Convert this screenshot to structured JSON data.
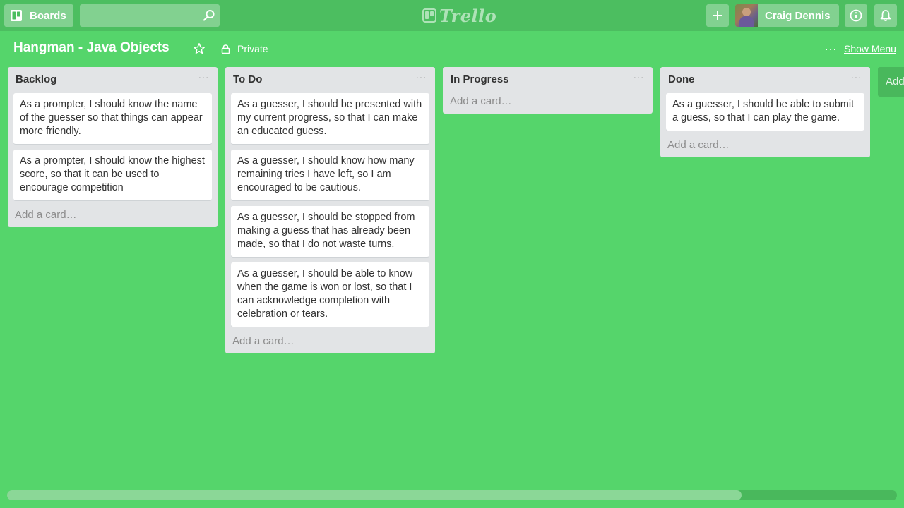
{
  "header": {
    "boards_label": "Boards",
    "search_value": "",
    "logo_text": "Trello",
    "user_name": "Craig Dennis"
  },
  "board": {
    "title": "Hangman - Java Objects",
    "privacy_label": "Private",
    "show_menu_label": "Show Menu",
    "add_list_label": "Add a list…"
  },
  "lists": [
    {
      "title": "Backlog",
      "menu_glyph": "···",
      "cards": [
        "As a prompter, I should know the name of the guesser so that things can appear more friendly.",
        "As a prompter, I should know the highest score, so that it can be used to encourage competition"
      ],
      "add_card_label": "Add a card…"
    },
    {
      "title": "To Do",
      "menu_glyph": "···",
      "cards": [
        "As a guesser, I should be presented with my current progress, so that I can make an educated guess.",
        "As a guesser, I should know how many remaining tries I have left, so I am encouraged to be cautious.",
        "As a guesser, I should be stopped from making a guess that has already been made, so that I do not waste turns.",
        "As a guesser, I should be able to know when the game is won or lost, so that I can acknowledge completion with celebration or tears."
      ],
      "add_card_label": "Add a card…"
    },
    {
      "title": "In Progress",
      "menu_glyph": "···",
      "cards": [],
      "add_card_label": "Add a card…"
    },
    {
      "title": "Done",
      "menu_glyph": "···",
      "cards": [
        "As a guesser, I should be able to submit a guess, so that I can play the game."
      ],
      "add_card_label": "Add a card…"
    }
  ],
  "colors": {
    "background": "#55d56b",
    "header_bar": "#4cbe60",
    "list_bg": "#e2e4e6"
  }
}
